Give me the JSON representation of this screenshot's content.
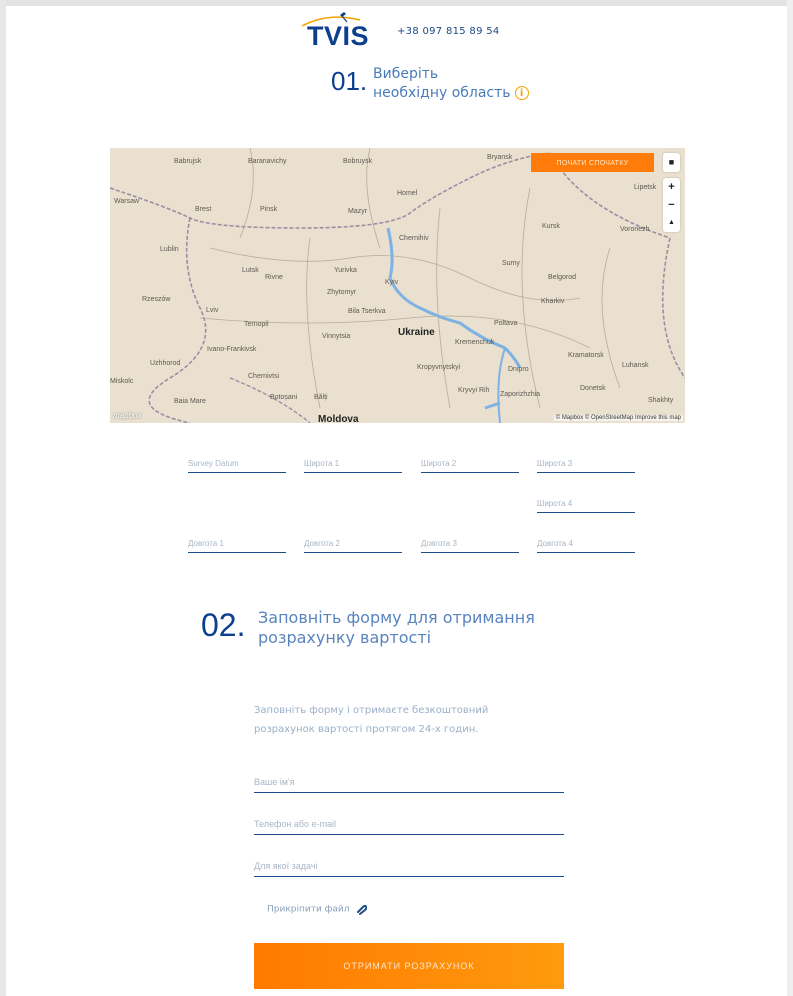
{
  "header": {
    "logo_text": "TVIS",
    "phone": "+38 097 815 89 54"
  },
  "step1": {
    "number": "01.",
    "title_line1": "Виберіть",
    "title_line2": "необхідну область",
    "info_icon": "i"
  },
  "map": {
    "start_button": "ПОЧАТИ СПОЧАТКУ",
    "draw_icon": "square-draw-icon",
    "zoom_in": "+",
    "zoom_out": "−",
    "compass": "▲",
    "attribution": "© Mapbox © OpenStreetMap Improve this map",
    "logo": "mapbox",
    "cities": [
      "Babrujsk",
      "Baranavichy",
      "Bobruysk",
      "Bryansk",
      "Warsaw",
      "Brest",
      "Pinsk",
      "Mazyr",
      "Homel",
      "Lipetsk",
      "Kursk",
      "Voronezh",
      "Lublin",
      "Chernihiv",
      "Lutsk",
      "Rivne",
      "Yurivka",
      "Zhytomyr",
      "Kyiv",
      "Sumy",
      "Belgorod",
      "Rzeszów",
      "Lviv",
      "Bila Tserkva",
      "Kharkiv",
      "Ternopil",
      "Vinnytsia",
      "Poltava",
      "Kremenchuk",
      "Ivano-Frankivsk",
      "Uzhhorod",
      "Kropyvnytskyi",
      "Dnipro",
      "Kramatorsk",
      "Luhansk",
      "Miskolc",
      "Chernivtsi",
      "Kryvyi Rih",
      "Zaporizhzhia",
      "Donetsk",
      "Baia Mare",
      "Botoșani",
      "Bălți",
      "Shakhty"
    ],
    "countries": [
      "Ukraine",
      "Moldova"
    ]
  },
  "coords": {
    "survey_datum": "Survey Datum",
    "lat1": "Широта 1",
    "lat2": "Широта 2",
    "lat3": "Широта 3",
    "lat4": "Широта 4",
    "lon1": "Довгота 1",
    "lon2": "Довгота 2",
    "lon3": "Довгота 3",
    "lon4": "Довгота 4"
  },
  "step2": {
    "number": "02.",
    "title_line1": "Заповніть форму для отримання",
    "title_line2": "розрахунку вартості",
    "description_line1": "Заповніть форму і отримаєте безкоштовний",
    "description_line2": "розрахунок вартості протягом 24-х годин.",
    "name_placeholder": "Ваше ім'я",
    "contact_placeholder": "Телефон або e-mail",
    "purpose_placeholder": "Для якої задачі",
    "attach_label": "Прикріпити файл",
    "submit_label": "ОТРИМАТИ РОЗРАХУНОК"
  },
  "colors": {
    "brand_blue": "#0c3f8d",
    "accent_orange": "#ff7c0a"
  }
}
